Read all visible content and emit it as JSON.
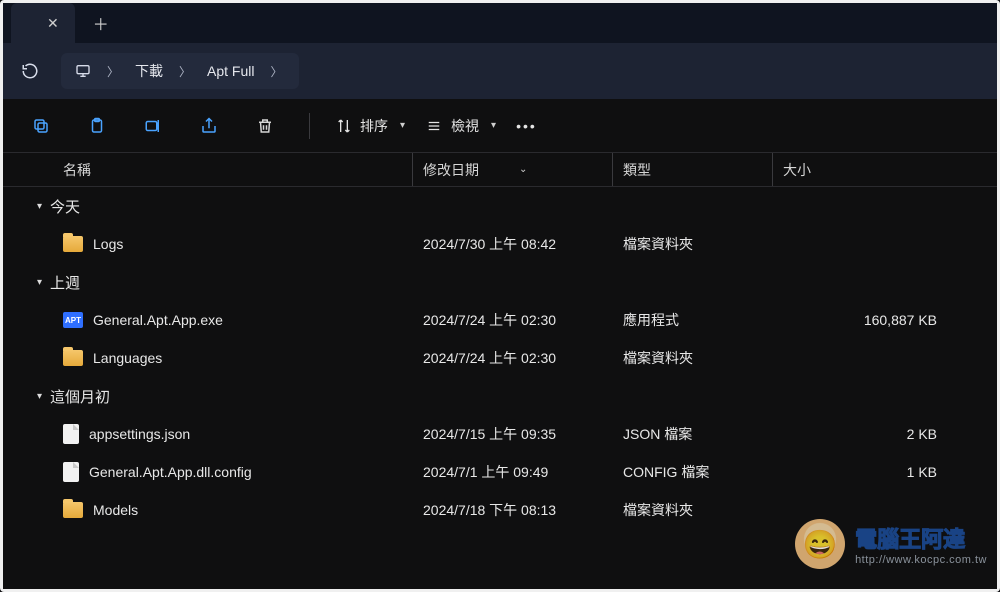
{
  "tab": {
    "title": ""
  },
  "breadcrumb": {
    "items": [
      "下載",
      "Apt Full"
    ]
  },
  "toolbar": {
    "sort_label": "排序",
    "view_label": "檢視"
  },
  "columns": {
    "name": "名稱",
    "date": "修改日期",
    "type": "類型",
    "size": "大小"
  },
  "groups": [
    {
      "label": "今天",
      "rows": [
        {
          "icon": "folder",
          "name": "Logs",
          "date": "2024/7/30 上午 08:42",
          "type": "檔案資料夾",
          "size": ""
        }
      ]
    },
    {
      "label": "上週",
      "rows": [
        {
          "icon": "apt",
          "name": "General.Apt.App.exe",
          "date": "2024/7/24 上午 02:30",
          "type": "應用程式",
          "size": "160,887 KB"
        },
        {
          "icon": "folder",
          "name": "Languages",
          "date": "2024/7/24 上午 02:30",
          "type": "檔案資料夾",
          "size": ""
        }
      ]
    },
    {
      "label": "這個月初",
      "rows": [
        {
          "icon": "file",
          "name": "appsettings.json",
          "date": "2024/7/15 上午 09:35",
          "type": "JSON 檔案",
          "size": "2 KB"
        },
        {
          "icon": "file",
          "name": "General.Apt.App.dll.config",
          "date": "2024/7/1 上午 09:49",
          "type": "CONFIG 檔案",
          "size": "1 KB"
        },
        {
          "icon": "folder",
          "name": "Models",
          "date": "2024/7/18 下午 08:13",
          "type": "檔案資料夾",
          "size": ""
        }
      ]
    }
  ],
  "icons": {
    "apt_badge": "APT"
  },
  "watermark": {
    "title": "電腦王阿達",
    "subtitle": "http://www.kocpc.com.tw"
  }
}
